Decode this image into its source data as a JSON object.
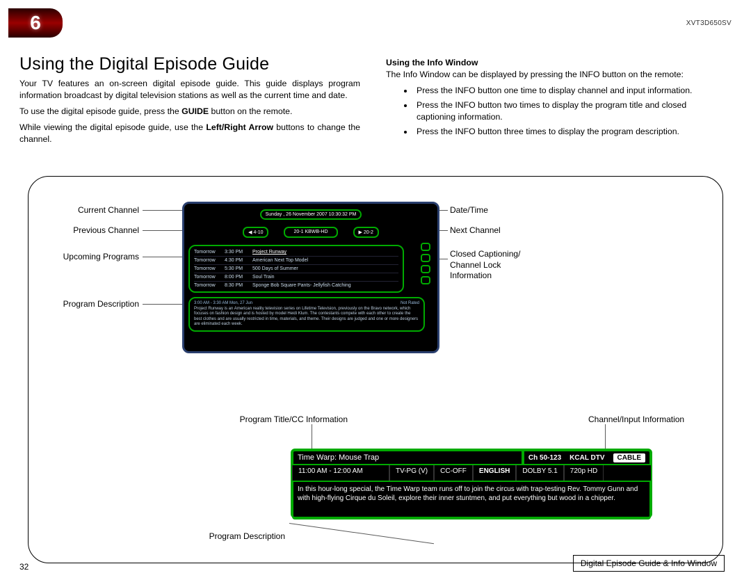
{
  "header": {
    "chapter_number": "6",
    "model_code": "XVT3D650SV",
    "section_title": "Using the Digital Episode Guide"
  },
  "left_intro": {
    "p1": "Your TV features an on-screen digital episode guide. This guide displays program information broadcast by digital television stations as well as the current time and date.",
    "p2_prefix": "To use the digital episode guide, press the ",
    "p2_bold": "GUIDE",
    "p2_suffix": " button on the remote.",
    "p3_prefix": "While viewing the digital episode guide, use the ",
    "p3_bold": "Left/Right Arrow",
    "p3_suffix": " buttons to change the channel."
  },
  "right_intro": {
    "subheading": "Using the Info Window",
    "lead": "The Info Window can be displayed by pressing the INFO button on the remote:",
    "bullets": [
      "Press the INFO button one time to display channel and input information.",
      "Press the INFO button two times to display the program title and closed captioning information.",
      "Press the INFO button three times to display the program description."
    ]
  },
  "callouts_left": {
    "current_channel": "Current Channel",
    "previous_channel": "Previous Channel",
    "upcoming_programs": "Upcoming Programs",
    "program_description": "Program Description",
    "program_title_cc": "Program Title/CC Information",
    "program_description2": "Program Description"
  },
  "callouts_right": {
    "date_time": "Date/Time",
    "next_channel": "Next Channel",
    "cc_lock": "Closed Captioning/\nChannel Lock\nInformation",
    "channel_input": "Channel/Input Information"
  },
  "guide_mock": {
    "date_time_pill": "Sunday , 26 November 2007 10:30:32 PM",
    "prev": "◀ 4-10",
    "current": "20-1 KBWB-HD",
    "next": "▶ 20-2",
    "programs": [
      {
        "day": "Tomorrow",
        "time": "3:30 PM",
        "title": "Project Runway",
        "highlight": true
      },
      {
        "day": "Tomorrow",
        "time": "4:30 PM",
        "title": "American Next Top Model"
      },
      {
        "day": "Tomorrow",
        "time": "5:30 PM",
        "title": "500 Days of Summer"
      },
      {
        "day": "Tomorrow",
        "time": "8:00 PM",
        "title": "Soul Train"
      },
      {
        "day": "Tomorrow",
        "time": "8:30 PM",
        "title": "Sponge Bob Square Pants- Jellyfish Catching"
      }
    ],
    "desc_header_left": "3:00 AM - 3:30 AM Mon, 27 Jun",
    "desc_header_right": "Not Rated",
    "description": "Project Runway is an American reality television series on Lifetime Television, previously on the Bravo network, which focuses on fashion design and is hosted by model Heidi Klum. The contestants compete with each other to create the best clothes and are usually restricted in time, materials, and theme. Their designs are judged and one or more designers are eliminated each week."
  },
  "info_mock": {
    "title": "Time Warp: Mouse Trap",
    "ch": "Ch 50-123",
    "callsign": "KCAL DTV",
    "source": "CABLE",
    "time": "11:00 AM - 12:00 AM",
    "rating": "TV-PG (V)",
    "cc": "CC-OFF",
    "lang": "ENGLISH",
    "audio": "DOLBY 5.1",
    "res": "720p HD",
    "desc": "In this hour-long special, the Time Warp team runs off to join the circus with trap-testing Rev. Tommy Gunn and with high-flying Cirque du Soleil, explore their inner stuntmen, and put everything but wood in a chipper."
  },
  "figure_caption": "Digital Episode Guide & Info Window",
  "page_number": "32"
}
